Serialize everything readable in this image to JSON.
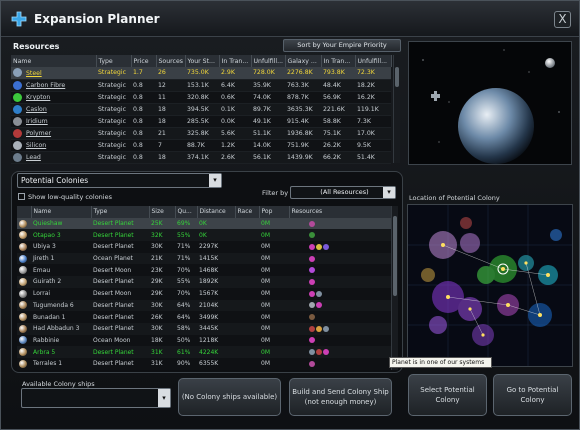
{
  "window": {
    "title": "Expansion Planner",
    "close_label": "X"
  },
  "resources": {
    "heading": "Resources",
    "sort_label": "Sort by Your Empire Priority",
    "columns": [
      "Name",
      "Type",
      "Price",
      "Sources",
      "Your St...",
      "In Tran...",
      "Unfulfill...",
      "Galaxy ...",
      "In Tran...",
      "Unfulfill..."
    ],
    "rows": [
      {
        "name": "Steel",
        "type": "Strategic",
        "price": "1.7",
        "sources": "26",
        "stock": "735.0K",
        "in_transit": "2.9K",
        "unfulfilled": "728.0K",
        "galaxy": "2276.8K",
        "galaxy_transit": "793.8K",
        "galaxy_unfulfilled": "72.3K",
        "color": "#8aa0b8"
      },
      {
        "name": "Carbon Fibre",
        "type": "Strategic",
        "price": "0.8",
        "sources": "12",
        "stock": "153.1K",
        "in_transit": "6.4K",
        "unfulfilled": "35.9K",
        "galaxy": "763.3K",
        "galaxy_transit": "48.4K",
        "galaxy_unfulfilled": "18.2K",
        "color": "#3b6fd1"
      },
      {
        "name": "Krypton",
        "type": "Strategic",
        "price": "0.8",
        "sources": "11",
        "stock": "320.8K",
        "in_transit": "0.6K",
        "unfulfilled": "74.0K",
        "galaxy": "878.7K",
        "galaxy_transit": "56.9K",
        "galaxy_unfulfilled": "16.2K",
        "color": "#3cc83c"
      },
      {
        "name": "Caslon",
        "type": "Strategic",
        "price": "0.8",
        "sources": "18",
        "stock": "394.5K",
        "in_transit": "0.1K",
        "unfulfilled": "89.7K",
        "galaxy": "3635.3K",
        "galaxy_transit": "221.6K",
        "galaxy_unfulfilled": "119.1K",
        "color": "#2e7ec9"
      },
      {
        "name": "Iridium",
        "type": "Strategic",
        "price": "0.8",
        "sources": "18",
        "stock": "285.5K",
        "in_transit": "0.0K",
        "unfulfilled": "49.1K",
        "galaxy": "915.4K",
        "galaxy_transit": "58.8K",
        "galaxy_unfulfilled": "7.3K",
        "color": "#8a8f96"
      },
      {
        "name": "Polymer",
        "type": "Strategic",
        "price": "0.8",
        "sources": "21",
        "stock": "325.8K",
        "in_transit": "5.6K",
        "unfulfilled": "51.1K",
        "galaxy": "1936.8K",
        "galaxy_transit": "75.1K",
        "galaxy_unfulfilled": "17.0K",
        "color": "#b33a3a"
      },
      {
        "name": "Silicon",
        "type": "Strategic",
        "price": "0.8",
        "sources": "7",
        "stock": "88.7K",
        "in_transit": "1.2K",
        "unfulfilled": "14.0K",
        "galaxy": "751.9K",
        "galaxy_transit": "26.2K",
        "galaxy_unfulfilled": "9.5K",
        "color": "#a9b0b8"
      },
      {
        "name": "Lead",
        "type": "Strategic",
        "price": "0.8",
        "sources": "18",
        "stock": "374.1K",
        "in_transit": "2.6K",
        "unfulfilled": "56.1K",
        "galaxy": "1439.9K",
        "galaxy_transit": "66.2K",
        "galaxy_unfulfilled": "51.4K",
        "color": "#6c7c8c"
      }
    ]
  },
  "colonies": {
    "dropdown_value": "Potential Colonies",
    "show_low_quality_label": "Show low-quality colonies",
    "filter_label": "Filter by",
    "filter_value": "(All Resources)",
    "columns": [
      "",
      "Name",
      "Type",
      "Size",
      "Qu...",
      "Distance",
      "Race",
      "Pop",
      "Resources"
    ],
    "rows": [
      {
        "name": "Quieshaw",
        "type": "Desert Planet",
        "size": "25K",
        "quality": "69%",
        "distance": "0K",
        "race": "",
        "pop": "0M",
        "planet_color": "#b08c5a",
        "res_colors": [
          "#b24a9a"
        ],
        "style": "green"
      },
      {
        "name": "Otapao 3",
        "type": "Desert Planet",
        "size": "32K",
        "quality": "55%",
        "distance": "0K",
        "race": "",
        "pop": "0M",
        "planet_color": "#c09a66",
        "res_colors": [
          "#3a8f3a"
        ],
        "style": "green"
      },
      {
        "name": "Ubiya 3",
        "type": "Desert Planet",
        "size": "30K",
        "quality": "71%",
        "distance": "2297K",
        "race": "",
        "pop": "0M",
        "planet_color": "#a8825a",
        "res_colors": [
          "#cc3fb4",
          "#d8c040",
          "#7a5ad8"
        ],
        "style": ""
      },
      {
        "name": "Jireth 1",
        "type": "Ocean Planet",
        "size": "21K",
        "quality": "71%",
        "distance": "1415K",
        "race": "",
        "pop": "0M",
        "planet_color": "#4a7fc9",
        "res_colors": [
          "#cc3fb4"
        ],
        "style": ""
      },
      {
        "name": "Emau",
        "type": "Desert Moon",
        "size": "23K",
        "quality": "70%",
        "distance": "1468K",
        "race": "",
        "pop": "0M",
        "planet_color": "#9a9a9a",
        "res_colors": [
          "#b24ad8"
        ],
        "style": ""
      },
      {
        "name": "Guirath 2",
        "type": "Desert Planet",
        "size": "29K",
        "quality": "55%",
        "distance": "1892K",
        "race": "",
        "pop": "0M",
        "planet_color": "#c0a070",
        "res_colors": [
          "#cc3fb4"
        ],
        "style": ""
      },
      {
        "name": "Lorrai",
        "type": "Desert Moon",
        "size": "29K",
        "quality": "70%",
        "distance": "1567K",
        "race": "",
        "pop": "0M",
        "planet_color": "#8a8a8a",
        "res_colors": [
          "#cc3fb4",
          "#8090a0"
        ],
        "style": ""
      },
      {
        "name": "Tugumenda 6",
        "type": "Desert Planet",
        "size": "30K",
        "quality": "64%",
        "distance": "2104K",
        "race": "",
        "pop": "0M",
        "planet_color": "#a88456",
        "res_colors": [
          "#a0a6ad",
          "#cc3fb4"
        ],
        "style": ""
      },
      {
        "name": "Bunadan 1",
        "type": "Desert Planet",
        "size": "26K",
        "quality": "64%",
        "distance": "3499K",
        "race": "",
        "pop": "0M",
        "planet_color": "#b29060",
        "res_colors": [
          "#7a5a40"
        ],
        "style": ""
      },
      {
        "name": "Had Abbadun 3",
        "type": "Desert Planet",
        "size": "30K",
        "quality": "58%",
        "distance": "3445K",
        "race": "",
        "pop": "0M",
        "planet_color": "#a07a50",
        "res_colors": [
          "#b04040",
          "#d8a040",
          "#8090a0"
        ],
        "style": ""
      },
      {
        "name": "Rabbinie",
        "type": "Ocean Moon",
        "size": "18K",
        "quality": "50%",
        "distance": "1218K",
        "race": "",
        "pop": "0M",
        "planet_color": "#5a86c0",
        "res_colors": [
          "#cc3fb4"
        ],
        "style": ""
      },
      {
        "name": "Arbra 5",
        "type": "Desert Planet",
        "size": "31K",
        "quality": "61%",
        "distance": "4224K",
        "race": "",
        "pop": "0M",
        "planet_color": "#b08c5a",
        "res_colors": [
          "#8090a0",
          "#b04040",
          "#cc3fb4"
        ],
        "style": "green"
      },
      {
        "name": "Terrales 1",
        "type": "Desert Planet",
        "size": "31K",
        "quality": "90%",
        "distance": "6355K",
        "race": "",
        "pop": "0M",
        "planet_color": "#a58555",
        "res_colors": [
          "#b24a9a"
        ],
        "style": ""
      }
    ]
  },
  "map": {
    "label": "Location of Potential Colony",
    "tooltip": "Planet is in one of our systems"
  },
  "ships": {
    "label": "Available Colony ships",
    "value": ""
  },
  "buttons": {
    "no_ships": "(No Colony ships available)",
    "build_send": "Build and Send Colony Ship (not enough money)",
    "select_colony": "Select Potential Colony",
    "go_to_colony": "Go to Potential Colony"
  }
}
